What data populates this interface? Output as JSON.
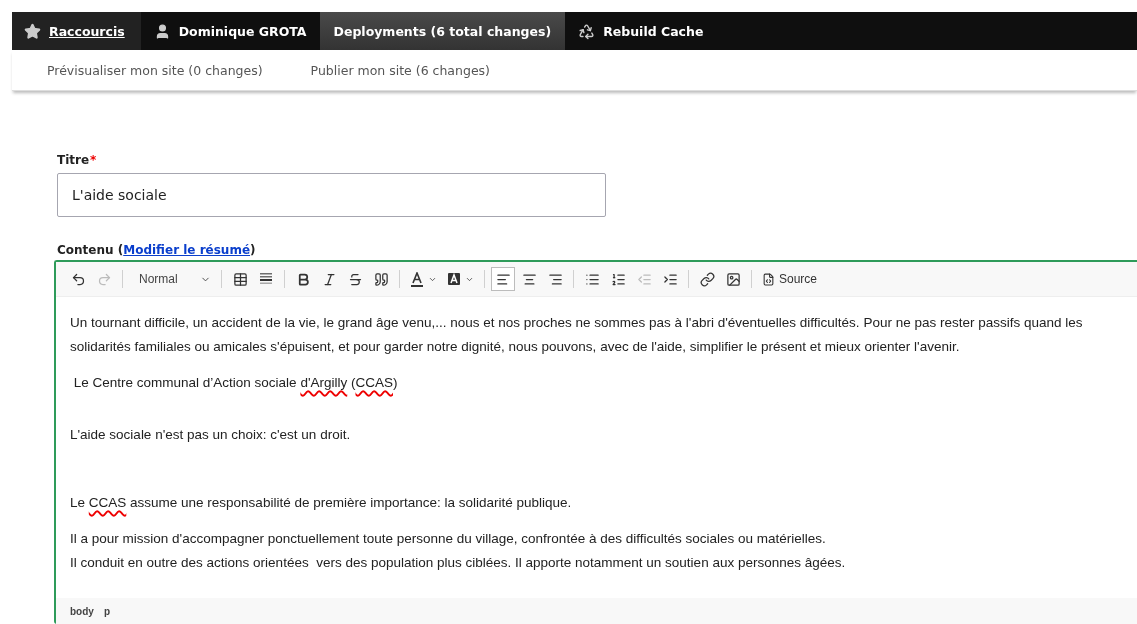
{
  "admin_bar": {
    "items": [
      {
        "kind": "star",
        "label": "Raccourcis",
        "selected": false
      },
      {
        "kind": "user",
        "label": "Dominique GROTA",
        "selected": false
      },
      {
        "kind": "plain",
        "label": "Deployments (6 total changes)",
        "selected": true
      },
      {
        "kind": "recycle",
        "label": "Rebuild Cache",
        "selected": false
      }
    ]
  },
  "sub_bar": {
    "links": [
      "Prévisualiser mon site (0 changes)",
      "Publier mon site (6 changes)"
    ]
  },
  "title_field": {
    "label": "Titre",
    "required_mark": "*",
    "value": "L'aide sociale"
  },
  "content_field": {
    "label": "Contenu",
    "link_open": "(",
    "link": "Modifier le résumé",
    "link_close": ")"
  },
  "toolbar": [
    {
      "kind": "undo",
      "disabled": false
    },
    {
      "kind": "redo",
      "disabled": true
    },
    {
      "kind": "separator"
    },
    {
      "kind": "format",
      "label": "Normal",
      "disabled": false
    },
    {
      "kind": "separator"
    },
    {
      "kind": "table",
      "disabled": false
    },
    {
      "kind": "rule",
      "disabled": false
    },
    {
      "kind": "separator"
    },
    {
      "kind": "bold",
      "disabled": false
    },
    {
      "kind": "italic",
      "disabled": false
    },
    {
      "kind": "strike",
      "disabled": false
    },
    {
      "kind": "quote",
      "disabled": false
    },
    {
      "kind": "separator"
    },
    {
      "kind": "textcolor",
      "disabled": false
    },
    {
      "kind": "bgcolor",
      "disabled": false
    },
    {
      "kind": "separator"
    },
    {
      "kind": "alignleft",
      "disabled": false,
      "selected": true
    },
    {
      "kind": "aligncenter",
      "disabled": false,
      "selected": false
    },
    {
      "kind": "alignright",
      "disabled": false,
      "selected": false
    },
    {
      "kind": "separator"
    },
    {
      "kind": "bullets",
      "disabled": false
    },
    {
      "kind": "numbers",
      "disabled": false
    },
    {
      "kind": "outdent",
      "disabled": true
    },
    {
      "kind": "indent",
      "disabled": false
    },
    {
      "kind": "separator"
    },
    {
      "kind": "link",
      "disabled": false
    },
    {
      "kind": "image",
      "disabled": false
    },
    {
      "kind": "separator"
    },
    {
      "kind": "source",
      "label": "Source",
      "disabled": false
    }
  ],
  "paragraphs": [
    {
      "kind": "text",
      "lines": [
        [
          {
            "text": "Un tournant difficile, un accident de la vie, le grand âge venu,... nous et nos proches ne sommes pas à l'abri d'éventuelles difficultés. Pour ne pas rester passifs quand les solidarités familiales ou amicales s'épuisent, et pour garder notre dignité, nous pouvons, avec de l'aide, simplifier le présent et mieux orienter l'avenir."
          }
        ]
      ]
    },
    {
      "kind": "text",
      "lines": [
        [
          {
            "text": " Le Centre communal d’Action sociale "
          },
          {
            "text": "d'Argilly",
            "misspelled": true
          },
          {
            "text": " ("
          },
          {
            "text": "CCAS",
            "misspelled": true
          },
          {
            "text": ")"
          }
        ]
      ]
    },
    {
      "kind": "blank"
    },
    {
      "kind": "text",
      "lines": [
        [
          {
            "text": "L'aide sociale n'est pas un choix: c'est un droit."
          }
        ]
      ]
    },
    {
      "kind": "blank"
    },
    {
      "kind": "blank"
    },
    {
      "kind": "text",
      "lines": [
        [
          {
            "text": "Le "
          },
          {
            "text": "CCAS",
            "misspelled": true
          },
          {
            "text": " assume une responsabilité de première importance: la solidarité publique."
          }
        ]
      ]
    },
    {
      "kind": "text",
      "lines": [
        [
          {
            "text": "Il a pour mission d'accompagner ponctuellement toute personne du village, confrontée à des difficultés sociales ou matérielles."
          }
        ],
        [
          {
            "text": "Il conduit en outre des actions orientées  vers des population plus ciblées. Il apporte notamment un soutien aux personnes âgées."
          }
        ]
      ]
    }
  ],
  "path_bar": [
    "body",
    "p"
  ]
}
